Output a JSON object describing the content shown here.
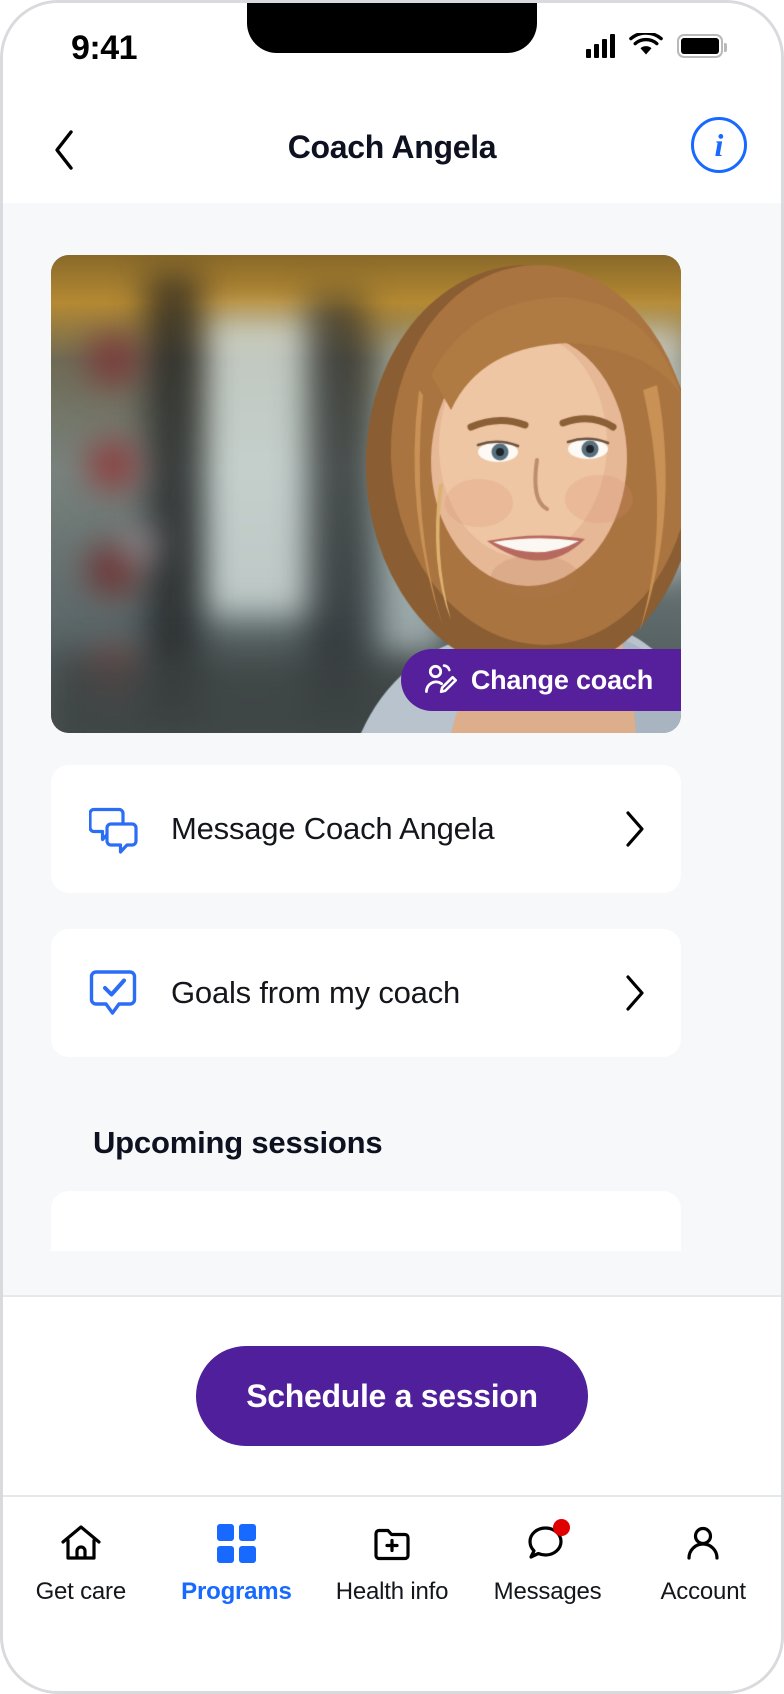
{
  "status_bar": {
    "time": "9:41",
    "signal_icon": "cellular-signal-icon",
    "wifi_icon": "wifi-icon",
    "battery_icon": "battery-full-icon"
  },
  "nav_bar": {
    "back_icon": "chevron-left-icon",
    "title": "Coach Angela",
    "info_icon": "info-circle-icon",
    "info_glyph": "i"
  },
  "coach": {
    "photo_alt": "Coach Angela portrait in gym",
    "change_coach_label": "Change coach",
    "change_coach_icon": "person-edit-icon"
  },
  "actions": [
    {
      "key": "message",
      "label": "Message Coach Angela",
      "icon": "chat-bubbles-icon",
      "chevron": "chevron-right-icon"
    },
    {
      "key": "goals",
      "label": "Goals from my coach",
      "icon": "checkmark-bubble-icon",
      "chevron": "chevron-right-icon"
    }
  ],
  "sections": {
    "upcoming_sessions_heading": "Upcoming sessions"
  },
  "cta": {
    "schedule_label": "Schedule a session"
  },
  "tab_bar": {
    "items": [
      {
        "label": "Get care",
        "icon": "home-icon",
        "active": false,
        "badge": false
      },
      {
        "label": "Programs",
        "icon": "grid-squares-icon",
        "active": true,
        "badge": false
      },
      {
        "label": "Health info",
        "icon": "folder-plus-icon",
        "active": false,
        "badge": false
      },
      {
        "label": "Messages",
        "icon": "chat-bubble-icon",
        "active": false,
        "badge": true
      },
      {
        "label": "Account",
        "icon": "person-icon",
        "active": false,
        "badge": false
      }
    ]
  },
  "colors": {
    "brand_purple": "#4F1F9C",
    "change_coach_purple": "#561F9C",
    "accent_blue": "#1769FF",
    "page_background": "#F7F8FA",
    "card_background": "#FFFFFF",
    "text_primary": "#0D1120",
    "badge_red": "#E00000"
  }
}
